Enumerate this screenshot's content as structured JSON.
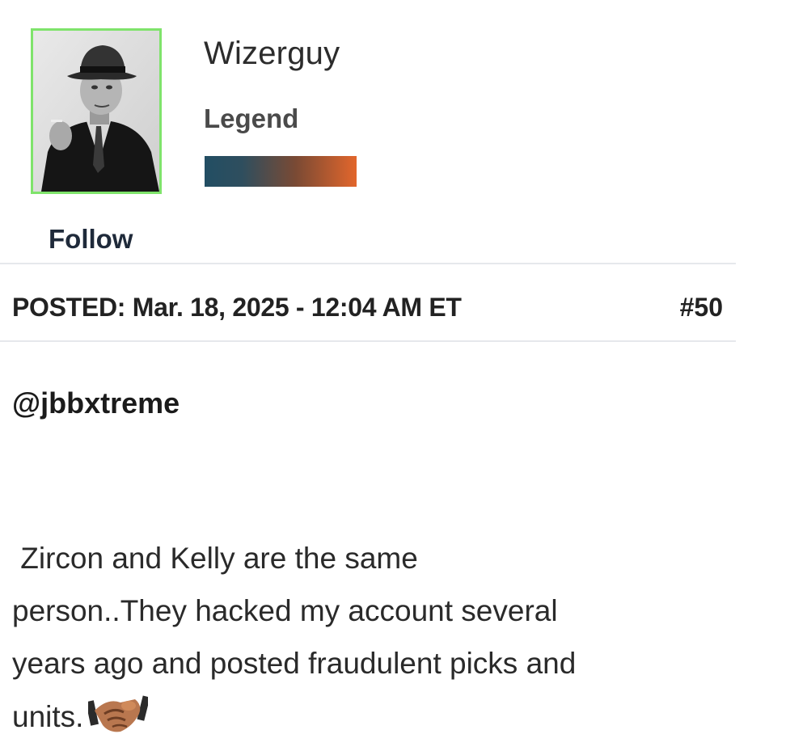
{
  "user": {
    "name": "Wizerguy",
    "rank": "Legend",
    "follow_label": "Follow",
    "rank_bar_colors": [
      "#224e63",
      "#e2662c"
    ],
    "avatar_border_color": "#7fe36b"
  },
  "post": {
    "posted_label": "POSTED: Mar. 18, 2025 - 12:04 AM ET",
    "number": "#50",
    "mention": "@jbbxtreme",
    "body_lines": [
      " Zircon and Kelly are the same",
      "person..They hacked my account several",
      "years ago and posted fraudulent picks and",
      "units."
    ],
    "emoji": "handshake-emoji"
  }
}
